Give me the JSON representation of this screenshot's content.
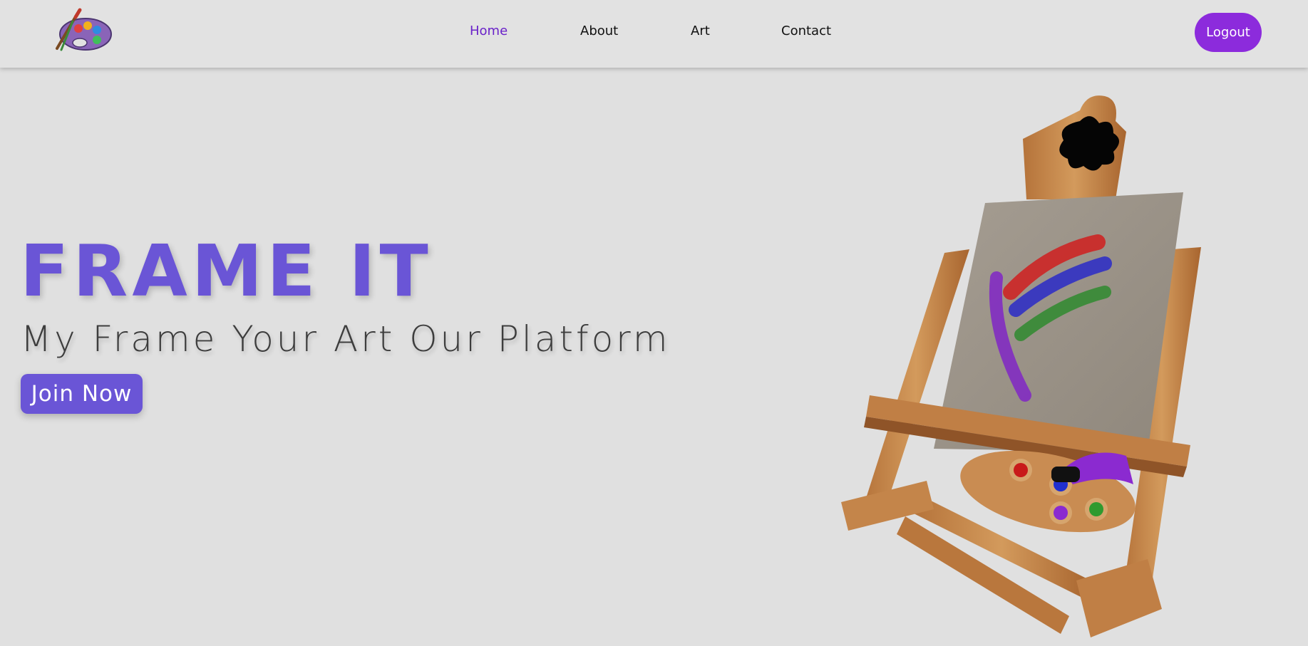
{
  "nav": {
    "logo": "palette-logo-icon",
    "links": [
      {
        "label": "Home",
        "active": true
      },
      {
        "label": "About",
        "active": false
      },
      {
        "label": "Art",
        "active": false
      },
      {
        "label": "Contact",
        "active": false
      }
    ],
    "logout_label": "Logout"
  },
  "hero": {
    "title": "FRAME IT",
    "subtitle": "My Frame Your Art Our Platform",
    "cta_label": "Join Now",
    "illustration": "easel-with-canvas-and-palette"
  },
  "colors": {
    "background": "#e0e0e0",
    "nav_active": "#6a22c9",
    "logout_button": "#8c2bdc",
    "hero_accent": "#6a55d6",
    "subtitle_text": "#3d3d3d"
  }
}
